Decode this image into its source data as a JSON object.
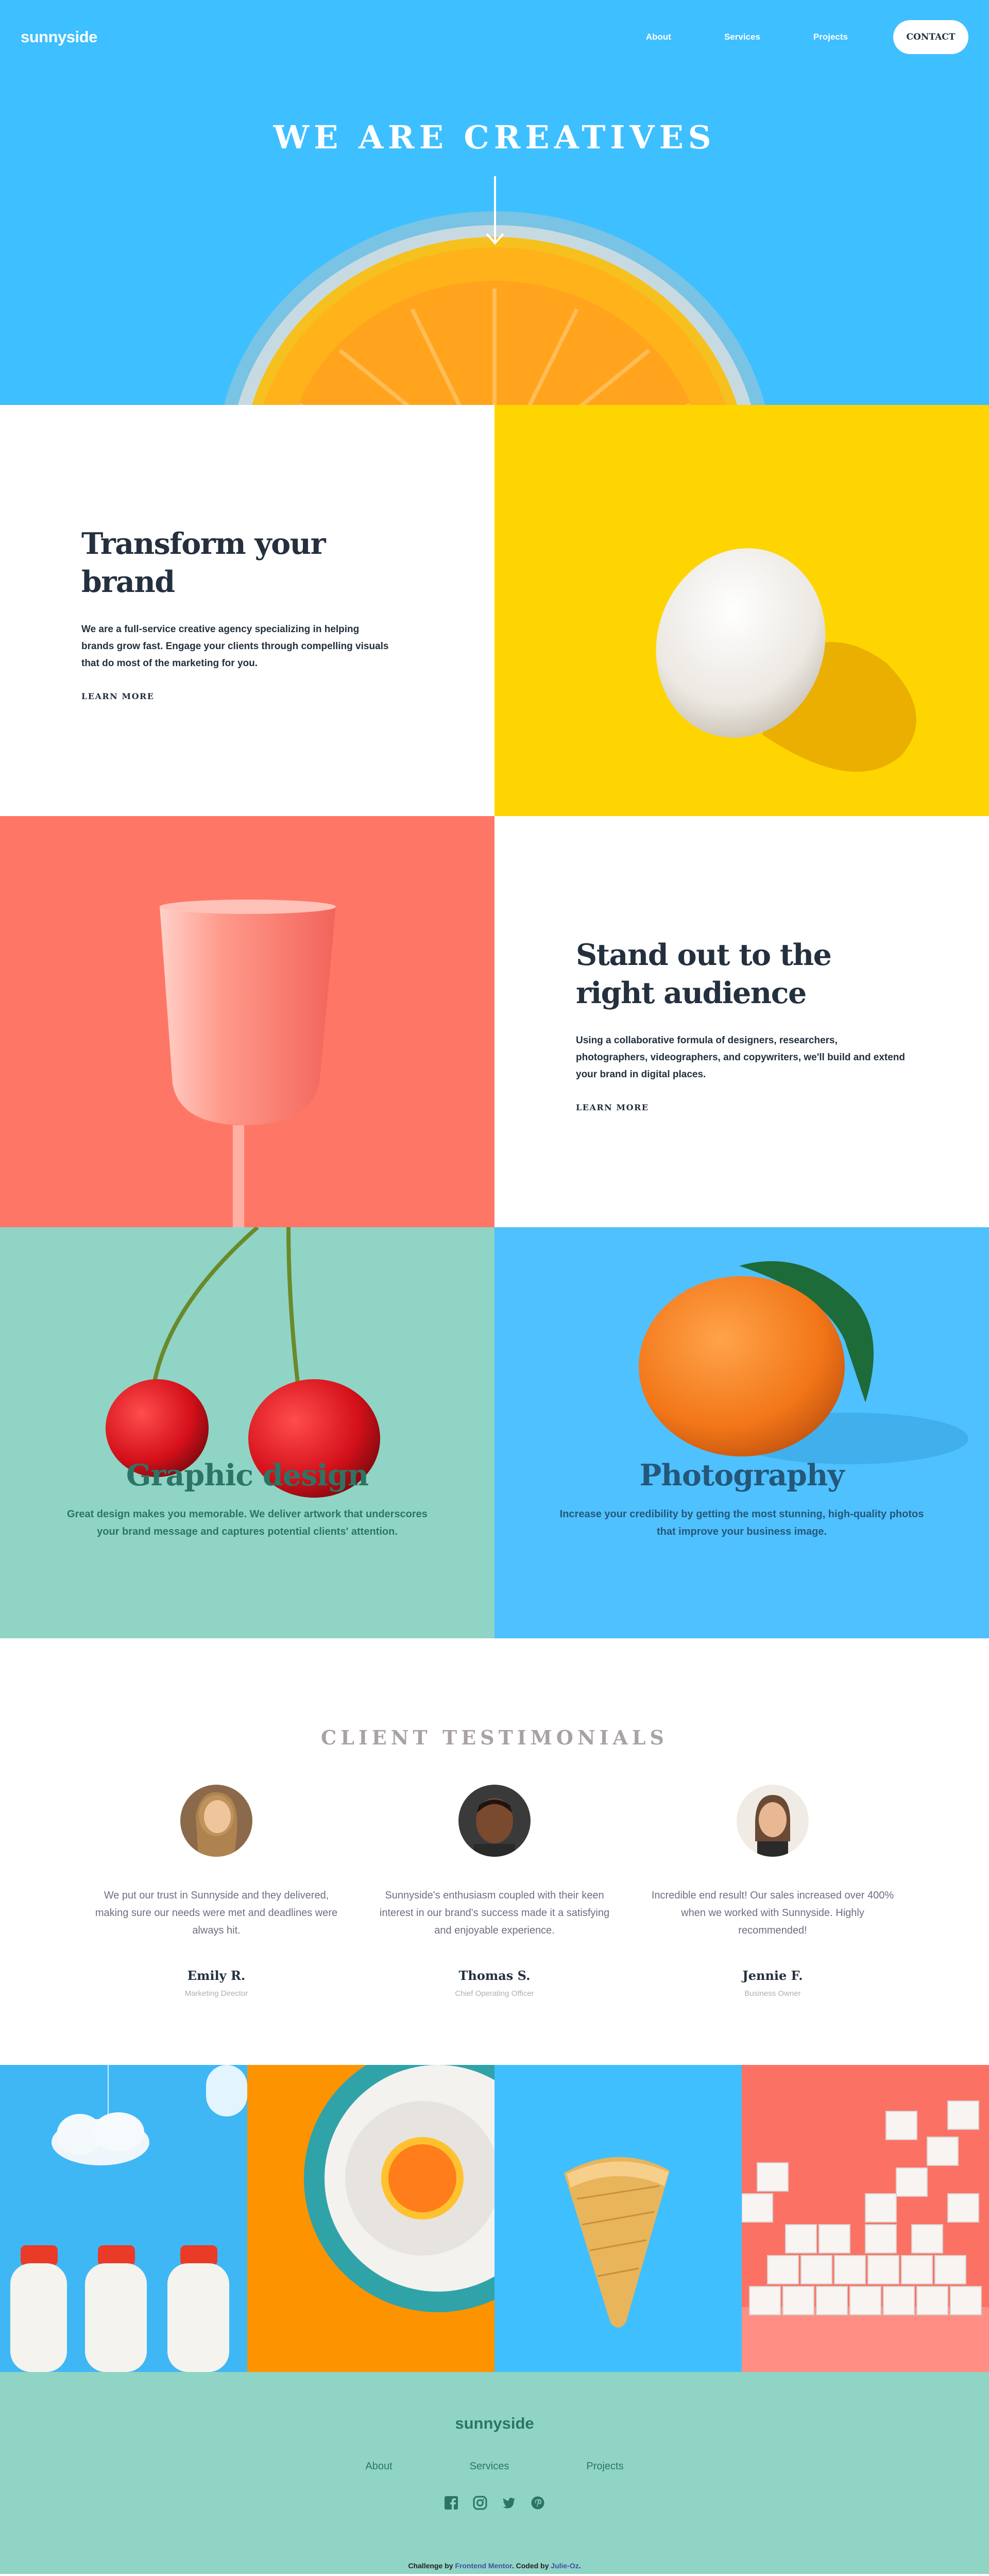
{
  "header": {
    "logo": "sunnyside",
    "nav": [
      "About",
      "Services",
      "Projects"
    ],
    "contact_label": "CONTACT"
  },
  "hero": {
    "title": "WE ARE CREATIVES",
    "arrow_icon": "arrow-down-icon"
  },
  "features": [
    {
      "title": "Transform your brand",
      "text": "We are a full-service creative agency specializing in helping brands grow fast. Engage your clients through compelling visuals that do most of the marketing for you.",
      "link": "LEARN MORE",
      "underline_color": "#fad400",
      "image": "egg-on-yellow"
    },
    {
      "title": "Stand out to the right audience",
      "text": "Using a collaborative formula of designers, researchers, photographers, videographers, and copywriters, we'll build and extend your brand in digital places.",
      "link": "LEARN MORE",
      "underline_color": "#fe7766",
      "image": "pink-cup-on-coral"
    }
  ],
  "services": [
    {
      "title": "Graphic design",
      "text": "Great design makes you memorable. We deliver artwork that underscores your brand message and captures potential clients' attention.",
      "color": "#2c7566",
      "bg": "#90d4c5"
    },
    {
      "title": "Photography",
      "text": "Increase your credibility by getting the most stunning, high-quality photos that improve your business image.",
      "color": "#24577a",
      "bg": "#4fc1ff"
    }
  ],
  "testimonials": {
    "title": "CLIENT TESTIMONIALS",
    "items": [
      {
        "quote": "We put our trust in Sunnyside and they delivered, making sure our needs were met and deadlines were always hit.",
        "name": "Emily R.",
        "role": "Marketing Director"
      },
      {
        "quote": "Sunnyside's enthusiasm coupled with their keen interest in our brand's success made it a satisfying and enjoyable experience.",
        "name": "Thomas S.",
        "role": "Chief Operating Officer"
      },
      {
        "quote": "Incredible end result! Our sales increased over 400% when we worked with Sunnyside. Highly recommended!",
        "name": "Jennie F.",
        "role": "Business Owner"
      }
    ]
  },
  "footer": {
    "logo": "sunnyside",
    "links": [
      "About",
      "Services",
      "Projects"
    ],
    "socials": [
      "facebook-icon",
      "instagram-icon",
      "twitter-icon",
      "pinterest-icon"
    ],
    "attribution_prefix": "Challenge by",
    "attribution_fm": "Frontend Mentor",
    "attribution_mid": ". Coded by",
    "attribution_author": "Julie-Oz",
    "attribution_suffix": "."
  },
  "colors": {
    "hero_bg": "#3ebfff",
    "egg_bg": "#fed501",
    "coral": "#fe7766",
    "mint": "#90d4c5",
    "blue": "#4fc1ff",
    "dark": "#24303e"
  }
}
